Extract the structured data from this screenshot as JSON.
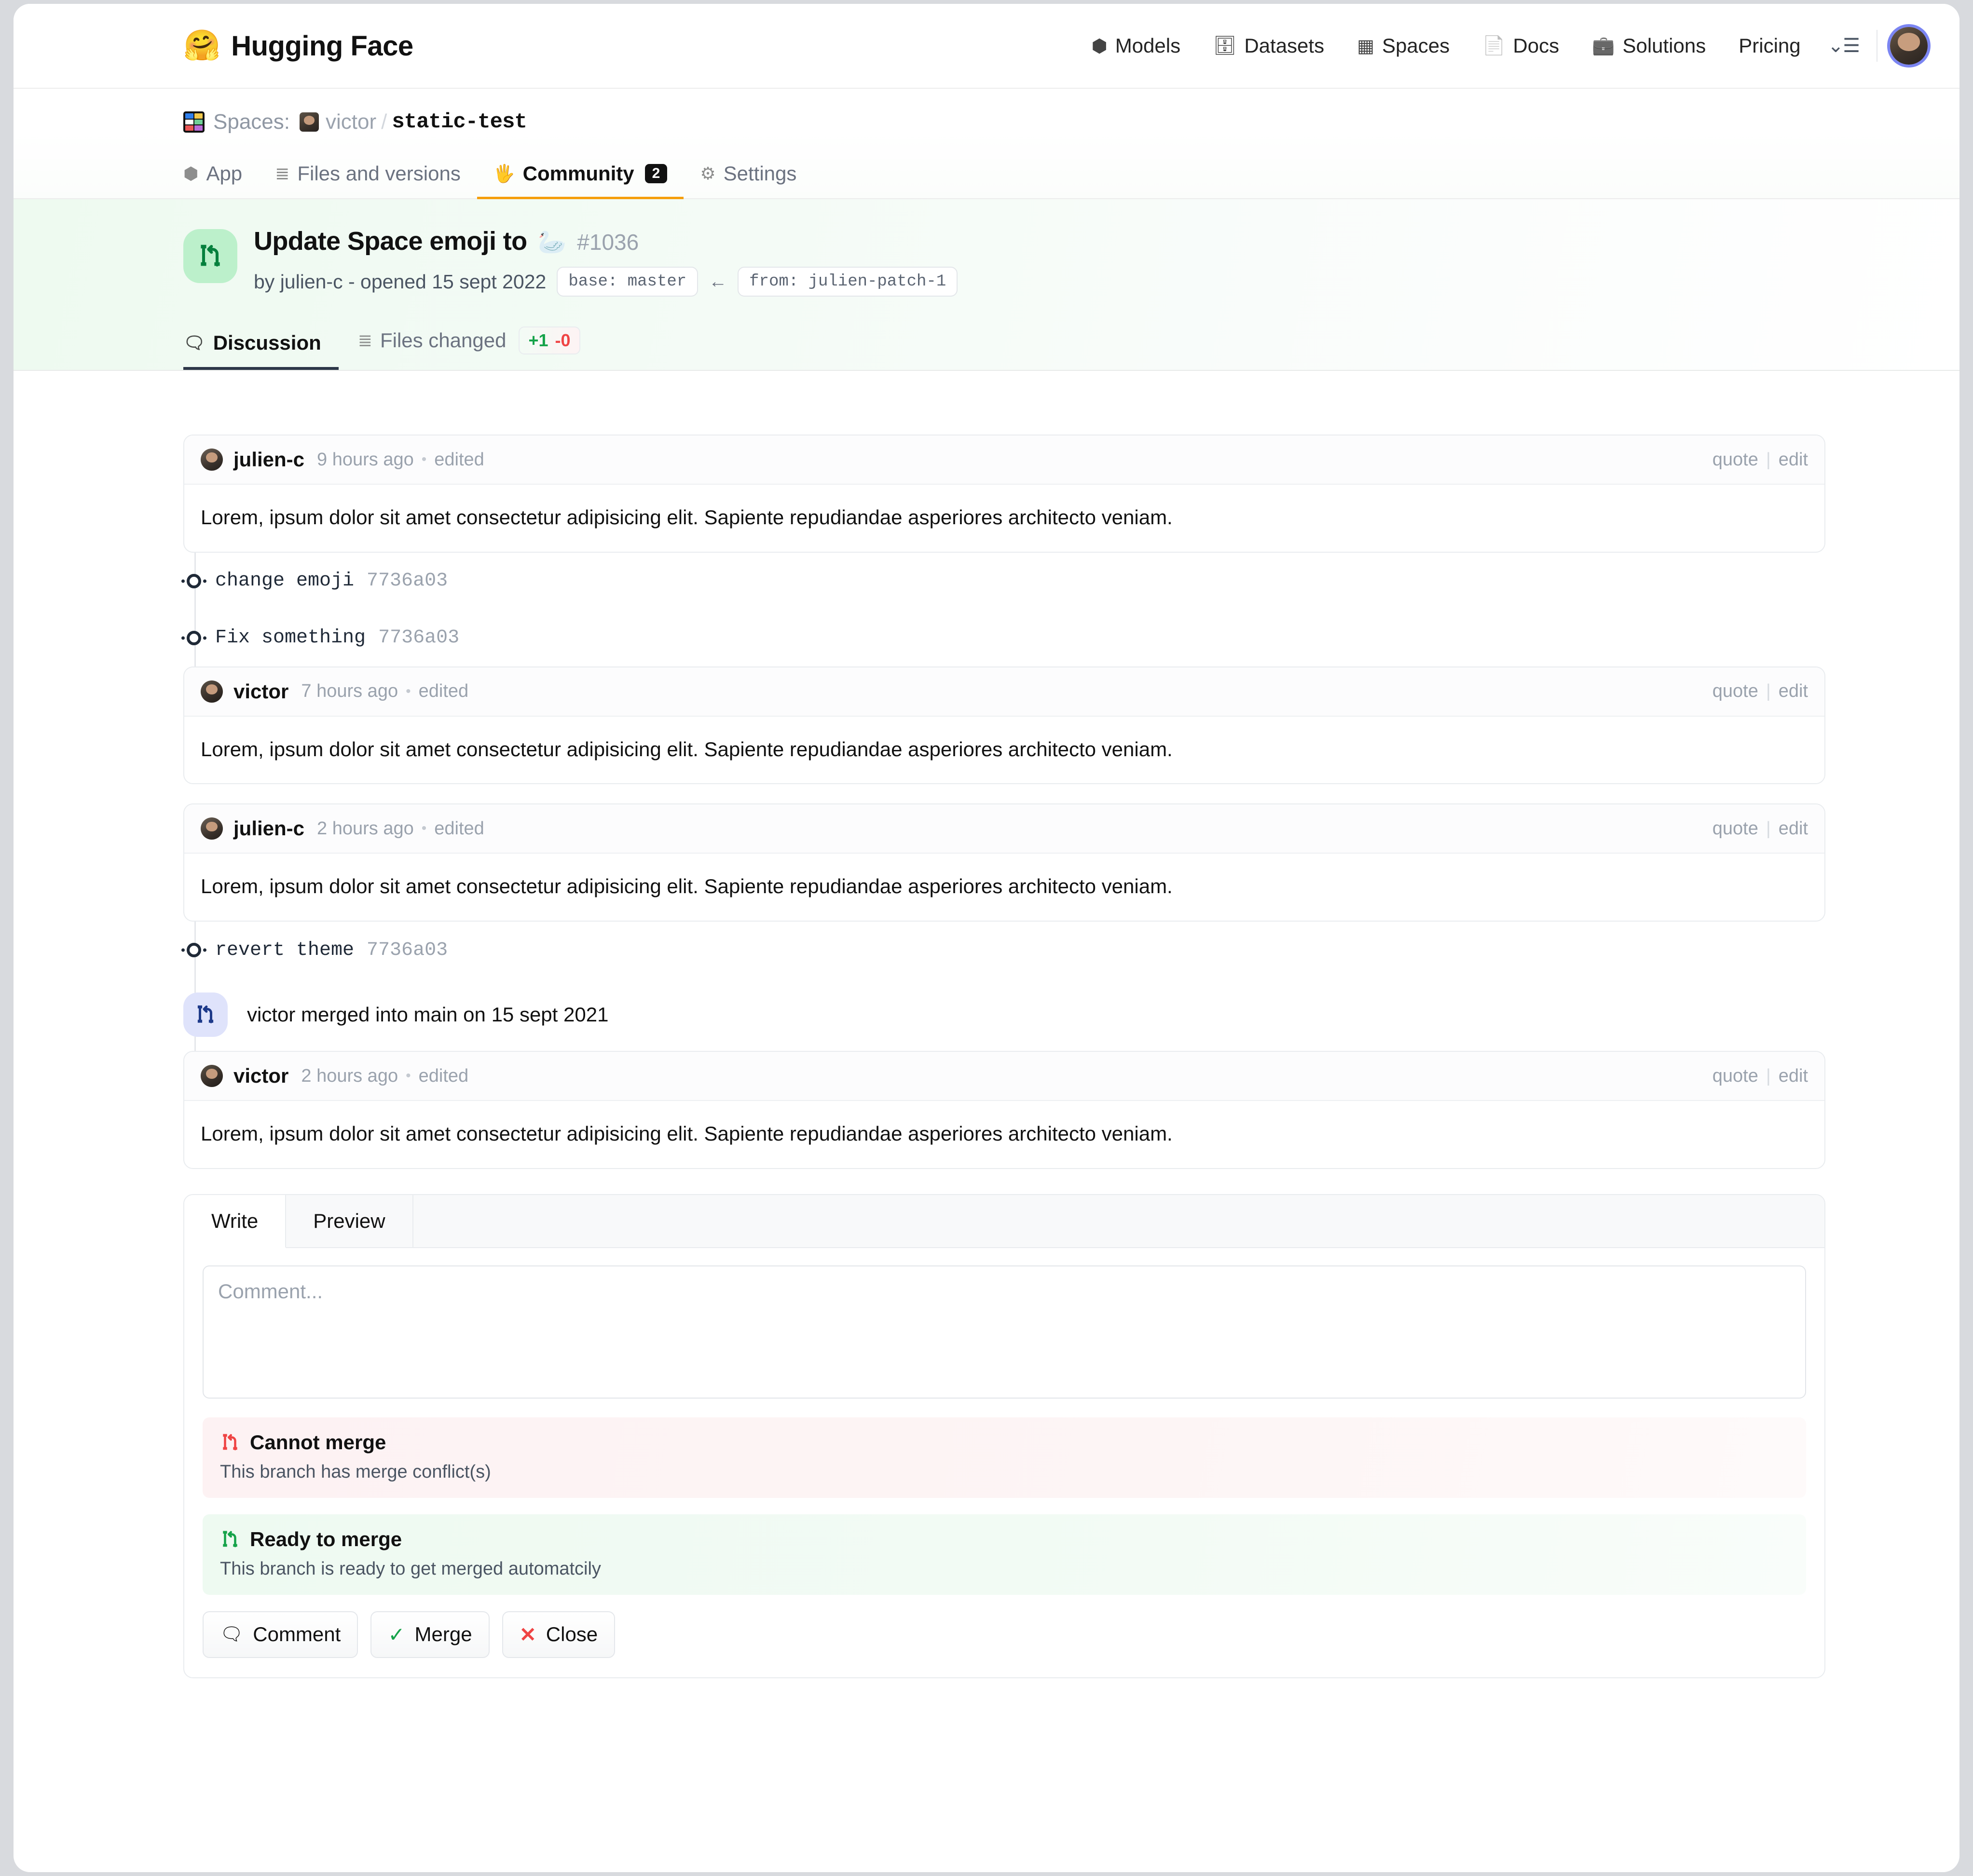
{
  "nav": {
    "brand": "Hugging Face",
    "brand_icon": "hugging-face-emoji",
    "items": [
      {
        "label": "Models",
        "icon": "cube-icon"
      },
      {
        "label": "Datasets",
        "icon": "database-icon"
      },
      {
        "label": "Spaces",
        "icon": "grid-icon"
      },
      {
        "label": "Docs",
        "icon": "document-icon"
      },
      {
        "label": "Solutions",
        "icon": "briefcase-icon"
      },
      {
        "label": "Pricing",
        "icon": ""
      }
    ],
    "menu_glyph": "⌄☰",
    "avatar_alt": "user-avatar"
  },
  "breadcrumb": {
    "section_label": "Spaces:",
    "owner": "victor",
    "separator": "/",
    "repo": "static-test"
  },
  "space_tabs": [
    {
      "label": "App",
      "icon": "cube-icon",
      "active": false,
      "badge": ""
    },
    {
      "label": "Files and versions",
      "icon": "files-icon",
      "active": false,
      "badge": ""
    },
    {
      "label": "Community",
      "icon": "wave-hand-icon",
      "active": true,
      "badge": "2"
    },
    {
      "label": "Settings",
      "icon": "gear-icon",
      "active": false,
      "badge": ""
    }
  ],
  "pr": {
    "badge_icon": "pull-request-icon",
    "title": "Update Space emoji to",
    "title_emoji": "🦢",
    "number": "#1036",
    "meta": "by julien-c - opened 15 sept 2022",
    "base_chip": "base: master",
    "arrow": "←",
    "from_chip": "from: julien-patch-1",
    "tabs": [
      {
        "label": "Discussion",
        "icon": "discussion-icon",
        "active": true
      },
      {
        "label": "Files changed",
        "icon": "files-icon",
        "active": false
      }
    ],
    "diff_added": "+1",
    "diff_removed": "-0"
  },
  "thread": [
    {
      "kind": "comment",
      "user": "julien-c",
      "avatar": "julien",
      "time": "9 hours ago",
      "dot": "•",
      "edited": "edited",
      "quote": "quote",
      "sep": "|",
      "edit": "edit",
      "body": "Lorem, ipsum dolor sit amet consectetur adipisicing elit. Sapiente repudiandae asperiores architecto veniam."
    },
    {
      "kind": "commit",
      "message": "change emoji",
      "sha": "7736a03"
    },
    {
      "kind": "commit",
      "message": "Fix something",
      "sha": "7736a03"
    },
    {
      "kind": "comment",
      "user": "victor",
      "avatar": "victor",
      "time": "7 hours ago",
      "dot": "•",
      "edited": "edited",
      "quote": "quote",
      "sep": "|",
      "edit": "edit",
      "body": "Lorem, ipsum dolor sit amet consectetur adipisicing elit. Sapiente repudiandae asperiores architecto veniam."
    },
    {
      "kind": "comment",
      "user": "julien-c",
      "avatar": "julien",
      "time": "2 hours ago",
      "dot": "•",
      "edited": "edited",
      "quote": "quote",
      "sep": "|",
      "edit": "edit",
      "body": "Lorem, ipsum dolor sit amet consectetur adipisicing elit. Sapiente repudiandae asperiores architecto veniam."
    },
    {
      "kind": "commit",
      "message": "revert theme",
      "sha": "7736a03"
    },
    {
      "kind": "merge",
      "icon": "pull-request-icon",
      "text": "victor merged into main on 15 sept 2021"
    },
    {
      "kind": "comment",
      "user": "victor",
      "avatar": "victor",
      "time": "2 hours ago",
      "dot": "•",
      "edited": "edited",
      "quote": "quote",
      "sep": "|",
      "edit": "edit",
      "body": "Lorem, ipsum dolor sit amet consectetur adipisicing elit. Sapiente repudiandae asperiores architecto veniam."
    }
  ],
  "composer": {
    "tabs": [
      {
        "label": "Write",
        "active": true
      },
      {
        "label": "Preview",
        "active": false
      }
    ],
    "placeholder": "Comment...",
    "value": "",
    "banners": [
      {
        "variant": "red",
        "icon": "pull-request-icon",
        "title": "Cannot merge",
        "subtitle": "This branch has merge conflict(s)"
      },
      {
        "variant": "green",
        "icon": "pull-request-icon",
        "title": "Ready to merge",
        "subtitle": "This branch is ready to get merged automatcily"
      }
    ],
    "buttons": [
      {
        "label": "Comment",
        "icon": "comment-icon"
      },
      {
        "label": "Merge",
        "icon": "check-icon"
      },
      {
        "label": "Close",
        "icon": "x-icon"
      }
    ]
  },
  "colors": {
    "accent_green": "#16a34a",
    "accent_red": "#ef4444",
    "badge_green_bg": "#bcf0cb",
    "merge_badge_bg": "#dfe3fb",
    "tab_underline_active": "#f59e0b",
    "text_primary": "#111111",
    "text_muted": "#9aa2ad"
  }
}
